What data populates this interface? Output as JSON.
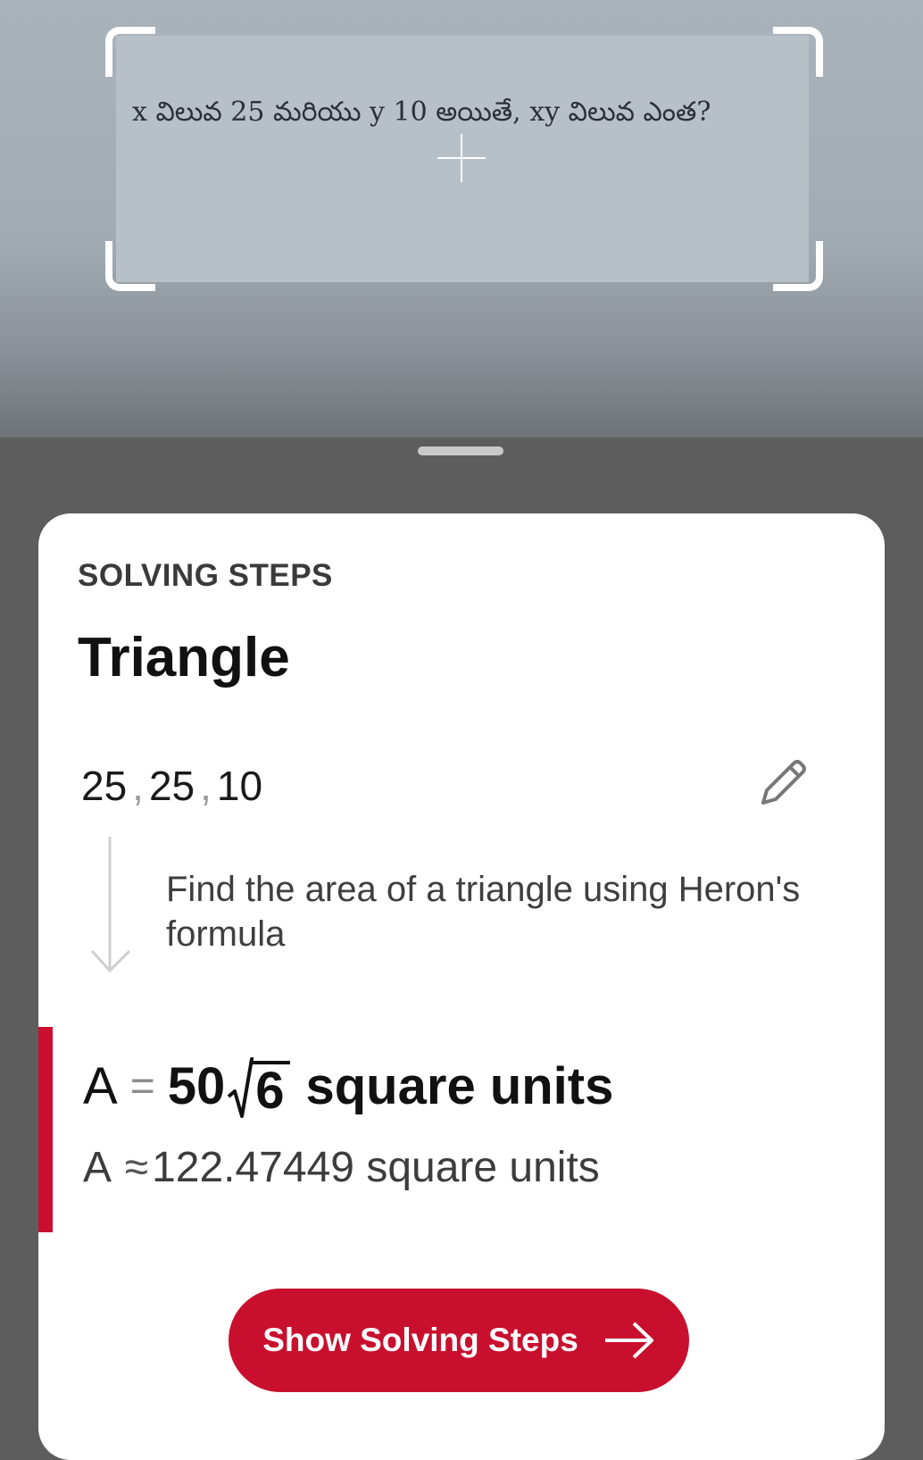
{
  "camera": {
    "question": "x విలువ 25 మరియు y 10 అయితే, xy విలువ ఎంత?"
  },
  "sheet": {
    "section_label": "SOLVING STEPS",
    "title": "Triangle",
    "inputs": [
      "25",
      "25",
      "10"
    ],
    "separator": ",",
    "step_text": "Find the area of a triangle using Heron's formula",
    "result": {
      "symbol": "A",
      "equals": "=",
      "coefficient": "50",
      "radicand": "6",
      "unit": "square units",
      "approx_symbol": "A",
      "approx_operator": "≈",
      "approx_value": "122.47449",
      "approx_unit": "square units"
    },
    "button_label": "Show Solving Steps"
  },
  "colors": {
    "accent": "#c8102e",
    "sheet_background": "#ffffff",
    "page_background": "#5d5d5d"
  },
  "icons": {
    "edit": "pencil-icon",
    "step": "arrow-down-icon",
    "cta": "arrow-right-icon"
  }
}
